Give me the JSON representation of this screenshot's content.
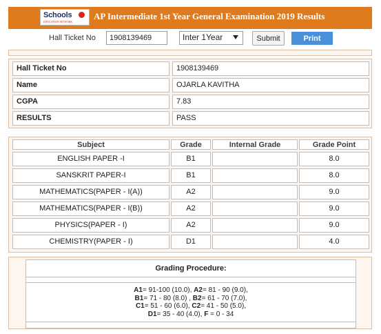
{
  "header": {
    "logo_text": "Schools",
    "logo_tagline": "EDUCATION NETWORK",
    "title": "AP Intermediate 1st Year General Examination 2019 Results"
  },
  "form": {
    "hall_ticket_label": "Hall Ticket No",
    "hall_ticket_value": "1908139469",
    "year_selected": "Inter 1Year",
    "submit_label": "Submit",
    "print_label": "Print"
  },
  "student": {
    "rows": [
      {
        "label": "Hall Ticket No",
        "value": "1908139469"
      },
      {
        "label": "Name",
        "value": "OJARLA KAVITHA"
      },
      {
        "label": "CGPA",
        "value": "7.83"
      },
      {
        "label": "RESULTS",
        "value": "PASS"
      }
    ]
  },
  "marks": {
    "headers": [
      "Subject",
      "Grade",
      "Internal Grade",
      "Grade Point"
    ],
    "rows": [
      {
        "subject": "ENGLISH PAPER -I",
        "grade": "B1",
        "internal": "",
        "point": "8.0"
      },
      {
        "subject": "SANSKRIT PAPER-I",
        "grade": "B1",
        "internal": "",
        "point": "8.0"
      },
      {
        "subject": "MATHEMATICS(PAPER - I(A))",
        "grade": "A2",
        "internal": "",
        "point": "9.0"
      },
      {
        "subject": "MATHEMATICS(PAPER - I(B))",
        "grade": "A2",
        "internal": "",
        "point": "9.0"
      },
      {
        "subject": "PHYSICS(PAPER - I)",
        "grade": "A2",
        "internal": "",
        "point": "9.0"
      },
      {
        "subject": "CHEMISTRY(PAPER - I)",
        "grade": "D1",
        "internal": "",
        "point": "4.0"
      }
    ]
  },
  "grading": {
    "title": "Grading Procedure:",
    "lines": [
      [
        {
          "grade": "A1",
          "range": "= 91-100 (10.0), "
        },
        {
          "grade": "A2",
          "range": "= 81 - 90 (9.0),"
        }
      ],
      [
        {
          "grade": "B1",
          "range": "= 71 - 80 (8.0) , "
        },
        {
          "grade": "B2",
          "range": "= 61 - 70 (7.0),"
        }
      ],
      [
        {
          "grade": "C1",
          "range": "= 51 - 60 (6.0), "
        },
        {
          "grade": "C2",
          "range": "= 41 - 50 (5.0),"
        }
      ],
      [
        {
          "grade": "D1",
          "range": "= 35 - 40 (4.0), "
        },
        {
          "grade": "F",
          "range": " = 0 - 34"
        }
      ]
    ]
  },
  "colors": {
    "header_bg": "#e07b1d",
    "print_button": "#4a90d9",
    "panel_bg": "#fdf5ee"
  }
}
